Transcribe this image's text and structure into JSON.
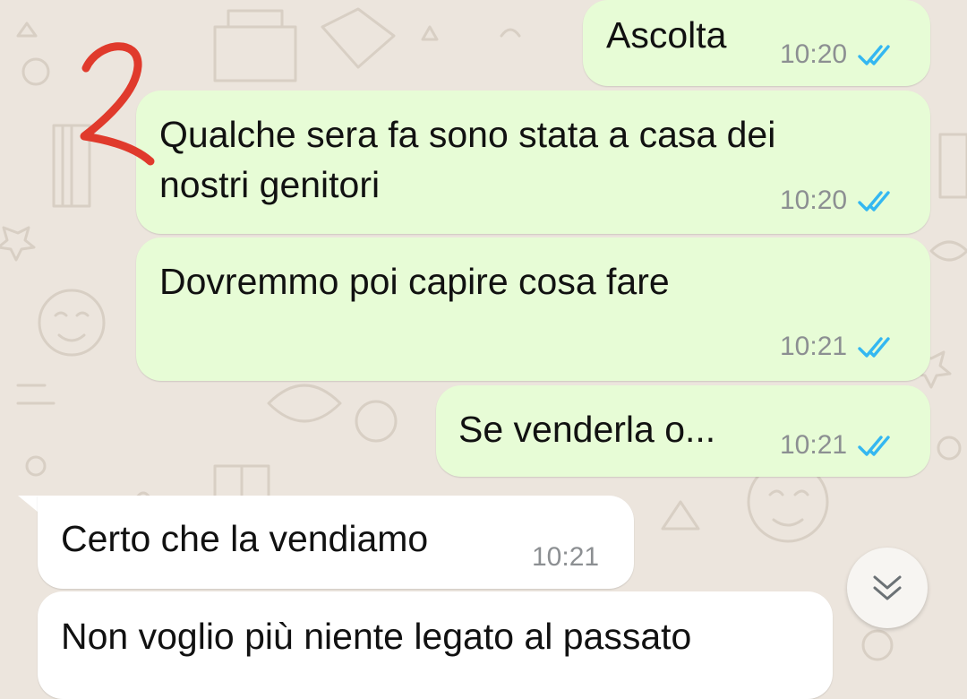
{
  "colors": {
    "outgoing_bubble": "#e7fcd6",
    "incoming_bubble": "#ffffff",
    "read_tick": "#34b7f1",
    "annotation": "#e03a2c",
    "wallpaper": "#ece5dd"
  },
  "annotation": {
    "label": "2"
  },
  "messages": [
    {
      "direction": "outgoing",
      "text": "Ascolta",
      "time": "10:20",
      "status": "read",
      "status_icon": "double-check-icon"
    },
    {
      "direction": "outgoing",
      "line1": "Qualche sera fa sono stata a casa dei",
      "line2": "nostri genitori",
      "time": "10:20",
      "status": "read",
      "status_icon": "double-check-icon"
    },
    {
      "direction": "outgoing",
      "text": "Dovremmo poi capire cosa fare",
      "time": "10:21",
      "status": "read",
      "status_icon": "double-check-icon"
    },
    {
      "direction": "outgoing",
      "text": "Se venderla o...",
      "time": "10:21",
      "status": "read",
      "status_icon": "double-check-icon"
    },
    {
      "direction": "incoming",
      "text": "Certo che la vendiamo",
      "time": "10:21"
    },
    {
      "direction": "incoming",
      "text": "Non voglio più niente legato al passato"
    }
  ],
  "scroll_button": {
    "icon": "double-chevron-down-icon"
  }
}
